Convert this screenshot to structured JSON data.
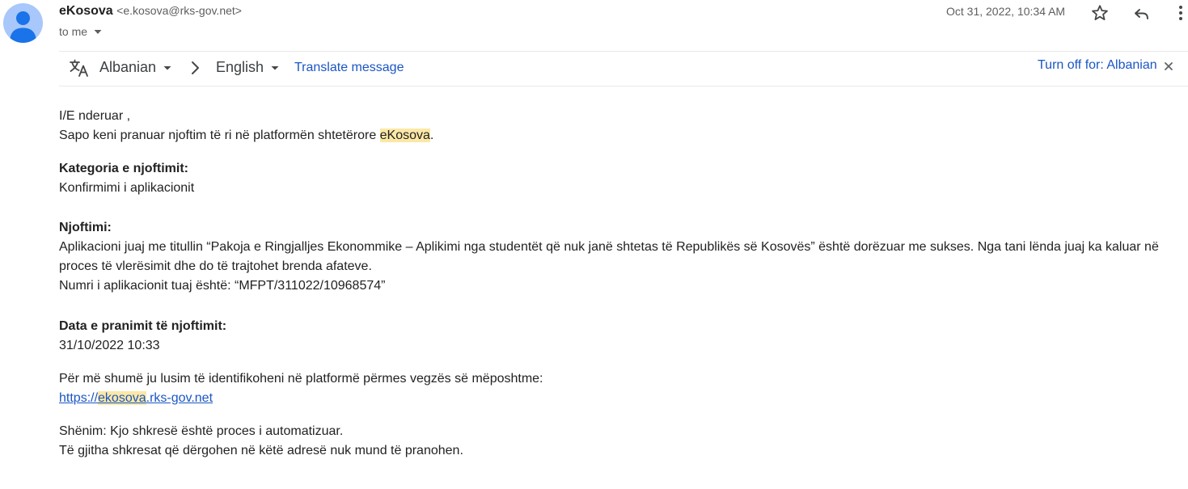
{
  "header": {
    "sender_name": "eKosova",
    "sender_email": "<e.kosova@rks-gov.net>",
    "to_label": "to me",
    "date": "Oct 31, 2022, 10:34 AM",
    "icons": {
      "avatar": "person-avatar-icon",
      "star": "star-icon",
      "reply": "reply-icon",
      "more": "more-vert-icon",
      "to_caret": "chevron-down-icon"
    }
  },
  "translate_bar": {
    "source_lang": "Albanian",
    "target_lang": "English",
    "translate_link": "Translate message",
    "turn_off": "Turn off for: Albanian",
    "icons": {
      "translate": "translate-icon",
      "arrow": "chevron-right-icon",
      "close": "close-icon"
    }
  },
  "message": {
    "greeting": "I/E nderuar ,",
    "intro_before": "Sapo keni pranuar njoftim të ri në platformën shtetërore ",
    "intro_highlight": "eKosova",
    "intro_after": ".",
    "category_label": "Kategoria e njoftimit:",
    "category_value": "Konfirmimi i aplikacionit",
    "notice_label": "Njoftimi:",
    "notice_line1": "Aplikacioni juaj me titullin “Pakoja e Ringjalljes Ekonommike – Aplikimi nga studentët që nuk janë shtetas të Republikës së Kosovës” është dorëzuar me sukses. Nga tani lënda juaj ka kaluar në",
    "notice_line2": "proces të vlerësimit dhe do të trajtohet brenda afateve.",
    "notice_line3": "Numri i aplikacionit tuaj është: “MFPT/311022/10968574”",
    "date_label": "Data e pranimit të njoftimit:",
    "date_value": "31/10/2022 10:33",
    "info_text": "Për më shumë ju lusim të identifikoheni në platformë përmes vegzës së mëposhtme:",
    "link_prefix": "https://",
    "link_highlight": "ekosova",
    "link_suffix": ".rks-gov.net",
    "note_line1": "Shënim: Kjo shkresë është proces i automatizuar.",
    "note_line2": "Të gjitha shkresat që dërgohen në këtë adresë nuk mund të pranohen."
  },
  "colors": {
    "link": "#1a56c4",
    "highlight": "#fce8a6",
    "avatar_bg": "#a8c7fa",
    "avatar_fg": "#1a73e8"
  }
}
